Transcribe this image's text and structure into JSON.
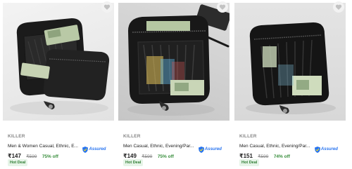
{
  "products": [
    {
      "brand": "KILLER",
      "title": "Men & Women Casual, Ethnic, E...",
      "assured_label": "Assured",
      "price": "₹147",
      "mrp": "₹599",
      "discount": "75% off",
      "badge": "Hot Deal",
      "wishlist_icon": "heart-outline-icon"
    },
    {
      "brand": "KILLER",
      "title": "Men Casual, Ethnic, Evening/Par...",
      "assured_label": "Assured",
      "price": "₹149",
      "mrp": "₹599",
      "discount": "75% off",
      "badge": "Hot Deal",
      "wishlist_icon": "heart-outline-icon"
    },
    {
      "brand": "KILLER",
      "title": "Men Casual, Ethnic, Evening/Par...",
      "assured_label": "Assured",
      "price": "₹151",
      "mrp": "₹599",
      "discount": "74% off",
      "badge": "Hot Deal",
      "wishlist_icon": "heart-outline-icon"
    }
  ],
  "colors": {
    "discount": "#388e3c",
    "assured": "#2874f0",
    "deal_bg": "#e6f4e8",
    "muted": "#878787"
  }
}
